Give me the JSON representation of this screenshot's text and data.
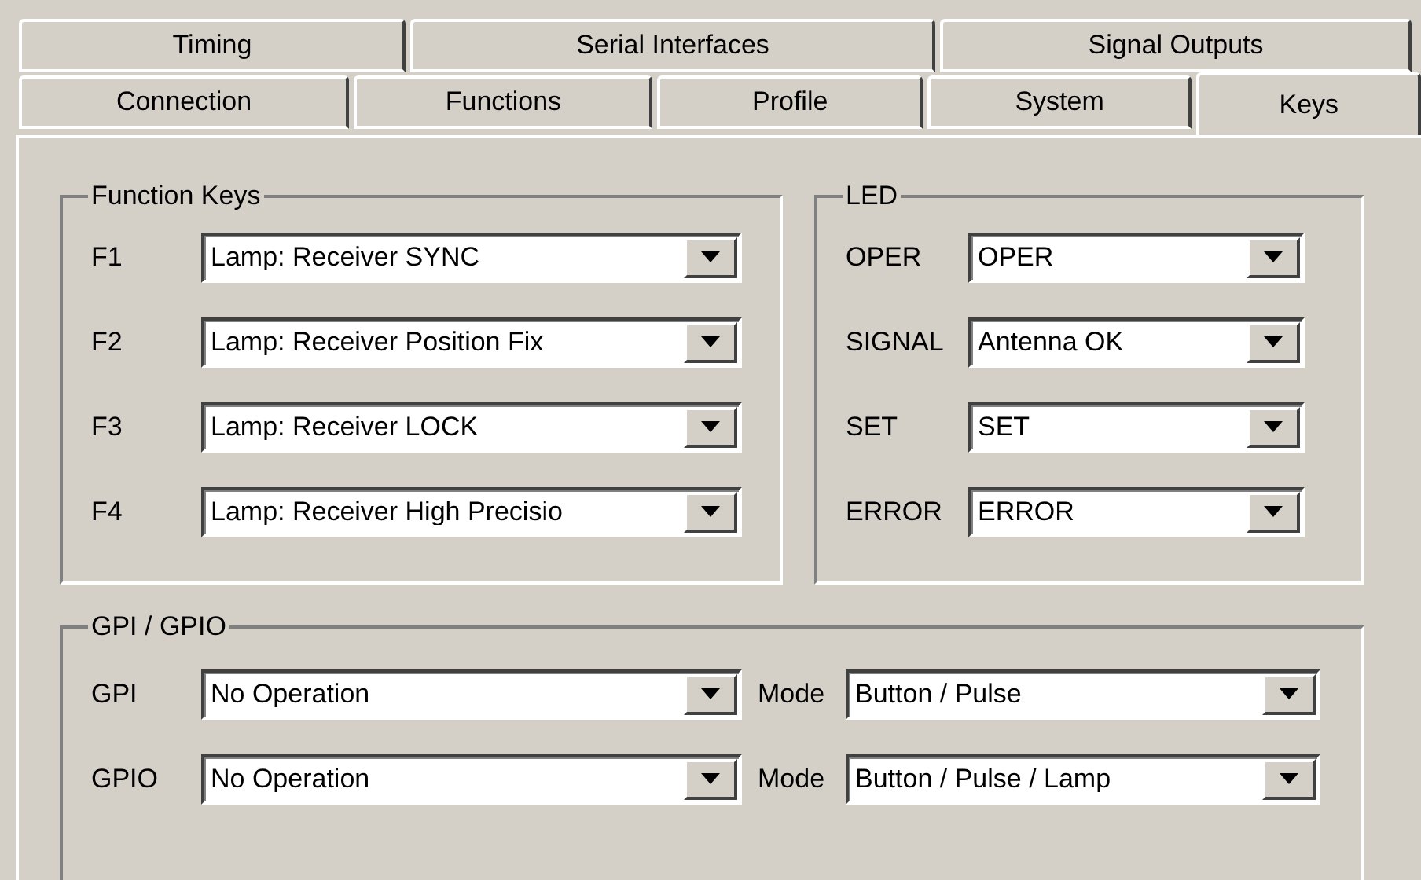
{
  "tab_rows": [
    [
      {
        "label": "Timing",
        "selected": false
      },
      {
        "label": "Serial Interfaces",
        "selected": false
      },
      {
        "label": "Signal Outputs",
        "selected": false
      }
    ],
    [
      {
        "label": "Connection",
        "selected": false
      },
      {
        "label": "Functions",
        "selected": false
      },
      {
        "label": "Profile",
        "selected": false
      },
      {
        "label": "System",
        "selected": false
      },
      {
        "label": "Keys",
        "selected": true
      }
    ]
  ],
  "function_keys": {
    "title": "Function Keys",
    "rows": [
      {
        "label": "F1",
        "value": "Lamp: Receiver SYNC"
      },
      {
        "label": "F2",
        "value": "Lamp: Receiver Position Fix"
      },
      {
        "label": "F3",
        "value": "Lamp: Receiver LOCK"
      },
      {
        "label": "F4",
        "value": "Lamp: Receiver High Precisio"
      }
    ]
  },
  "led": {
    "title": "LED",
    "rows": [
      {
        "label": "OPER",
        "value": "OPER"
      },
      {
        "label": "SIGNAL",
        "value": "Antenna OK"
      },
      {
        "label": "SET",
        "value": "SET"
      },
      {
        "label": "ERROR",
        "value": "ERROR"
      }
    ]
  },
  "gpi_gpio": {
    "title": "GPI / GPIO",
    "rows": [
      {
        "label": "GPI",
        "value": "No Operation",
        "mode_label": "Mode",
        "mode_value": "Button / Pulse"
      },
      {
        "label": "GPIO",
        "value": "No Operation",
        "mode_label": "Mode",
        "mode_value": "Button / Pulse / Lamp"
      }
    ]
  }
}
